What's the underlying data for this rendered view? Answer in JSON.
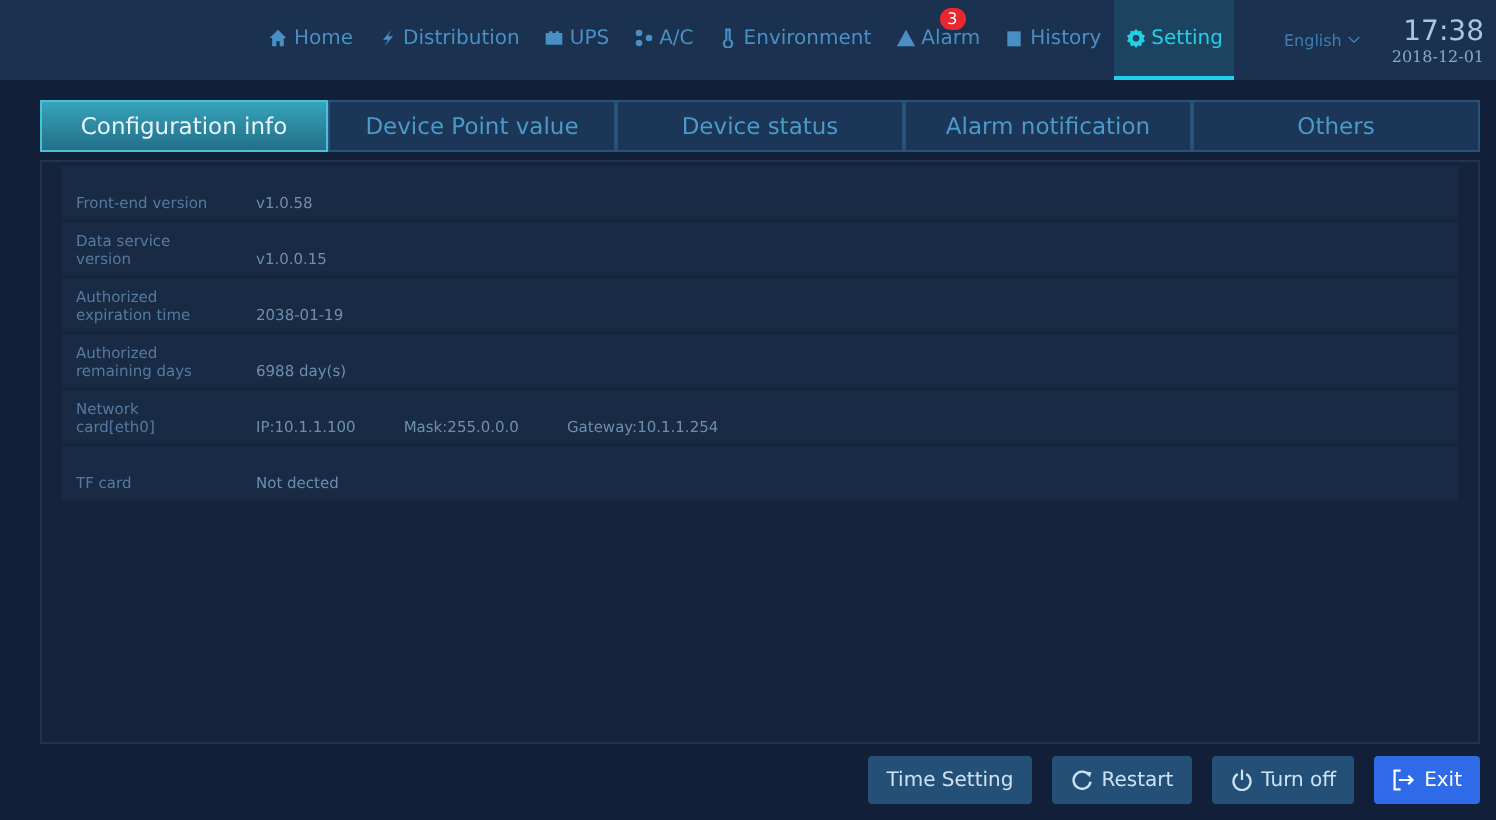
{
  "nav": [
    {
      "label": "Home",
      "selected": false
    },
    {
      "label": "Distribution",
      "selected": false
    },
    {
      "label": "UPS",
      "selected": false
    },
    {
      "label": "A/C",
      "selected": false
    },
    {
      "label": "Environment",
      "selected": false
    },
    {
      "label": "Alarm",
      "selected": false,
      "badge": "3"
    },
    {
      "label": "History",
      "selected": false
    },
    {
      "label": "Setting",
      "selected": true
    }
  ],
  "language": "English",
  "clock": {
    "time": "17:38",
    "date": "2018-12-01"
  },
  "tabs": [
    {
      "label": "Configuration info",
      "selected": true
    },
    {
      "label": "Device Point value",
      "selected": false
    },
    {
      "label": "Device status",
      "selected": false
    },
    {
      "label": "Alarm notification",
      "selected": false
    },
    {
      "label": "Others",
      "selected": false
    }
  ],
  "rows": [
    {
      "label": "Front-end version",
      "values": [
        "v1.0.58"
      ]
    },
    {
      "label": "Data service\nversion",
      "values": [
        "v1.0.0.15"
      ]
    },
    {
      "label": "Authorized\nexpiration time",
      "values": [
        "2038-01-19"
      ]
    },
    {
      "label": "Authorized\nremaining days",
      "values": [
        "6988 day(s)"
      ]
    },
    {
      "label": "Network\ncard[eth0]",
      "values": [
        "IP:10.1.1.100",
        "Mask:255.0.0.0",
        "Gateway:10.1.1.254"
      ]
    },
    {
      "label": "TF card",
      "values": [
        "Not dected"
      ]
    }
  ],
  "buttons": [
    {
      "label": "Time Setting",
      "kind": "plain"
    },
    {
      "label": "Restart",
      "kind": "restart"
    },
    {
      "label": "Turn off",
      "kind": "power"
    },
    {
      "label": "Exit",
      "kind": "exit"
    }
  ]
}
